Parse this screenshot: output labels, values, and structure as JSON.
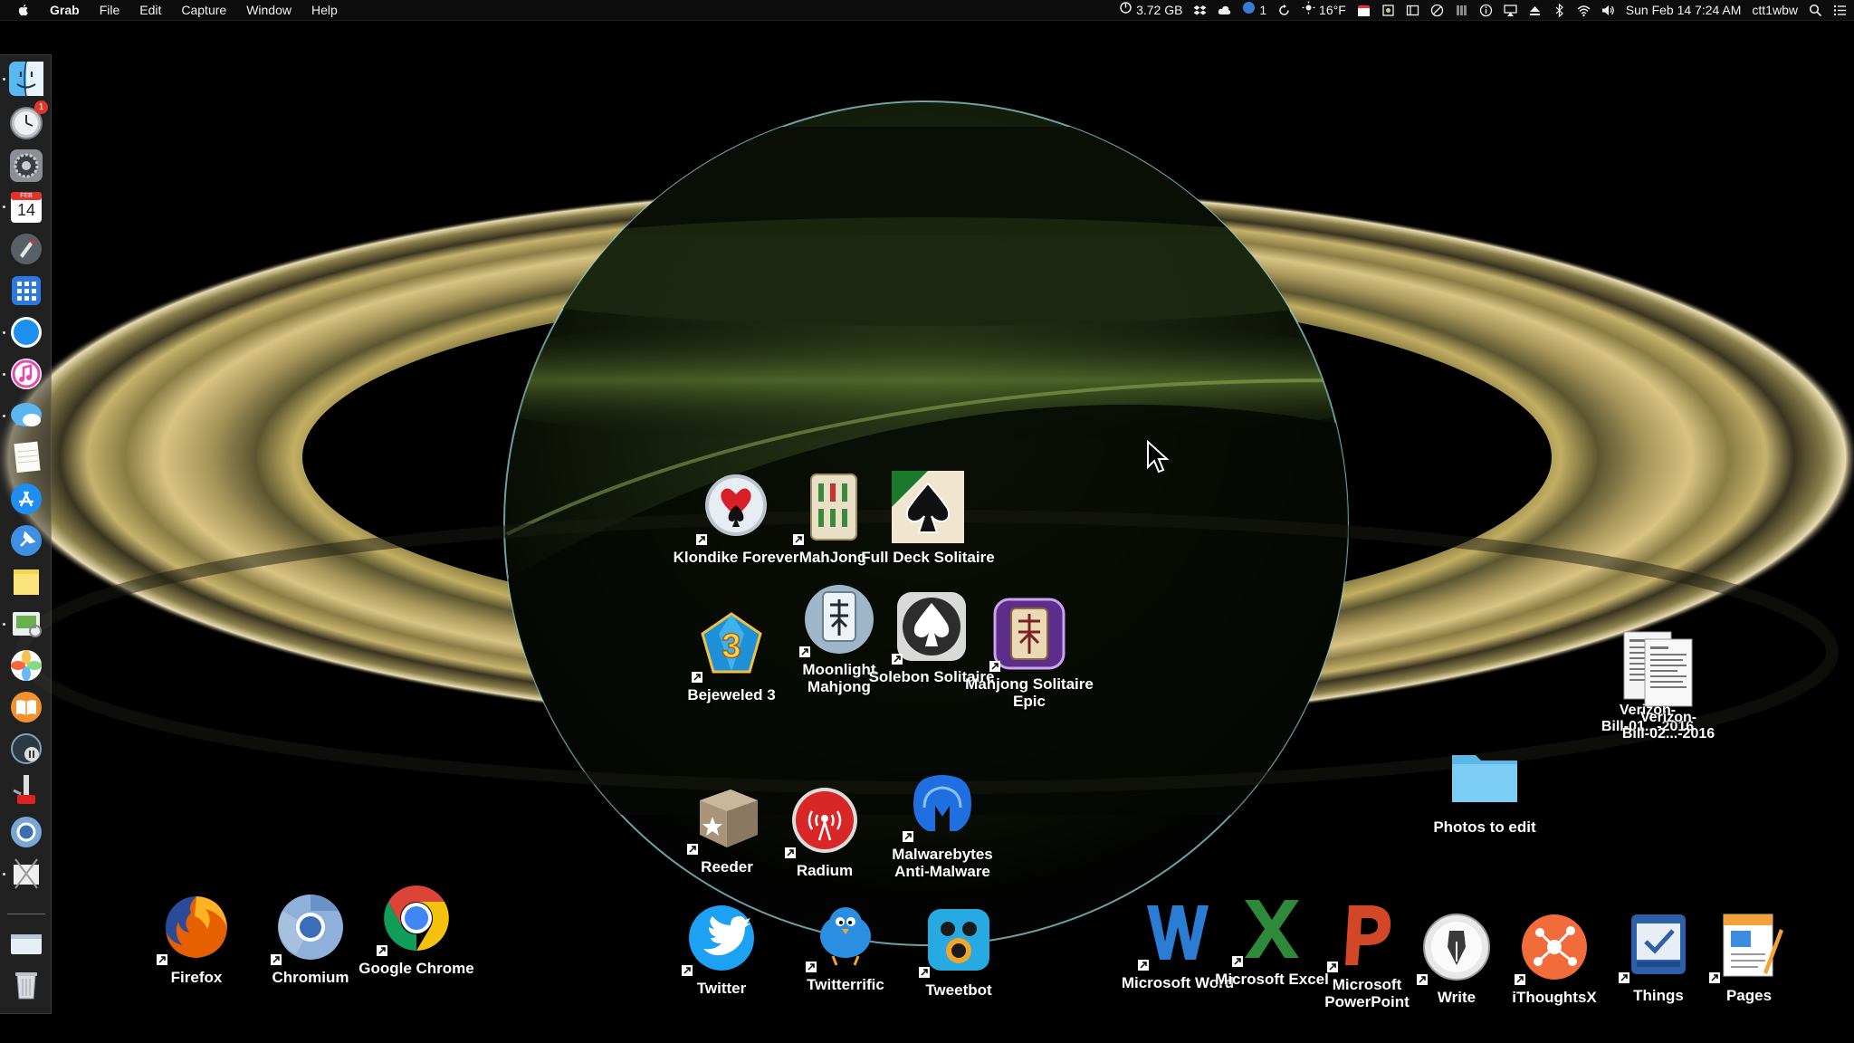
{
  "menubar": {
    "app_name": "Grab",
    "menus": [
      "File",
      "Edit",
      "Capture",
      "Window",
      "Help"
    ],
    "memory": "3.72 GB",
    "badge_count": "1",
    "weather": "16°F",
    "datetime": "Sun Feb 14  7:24 AM",
    "user": "ctt1wbw"
  },
  "dock": {
    "calendar_month": "FEB",
    "calendar_day": "14",
    "notification_badge": "1",
    "items": [
      "finder-icon",
      "clock-icon",
      "system-preferences-icon",
      "calendar-icon",
      "launchpad-icon",
      "dashboard-icon",
      "safari-icon",
      "itunes-icon",
      "messages-icon",
      "notes-icon",
      "app-store-icon",
      "pin-icon",
      "stickies-icon",
      "preview-icon",
      "photos-icon",
      "ibooks-icon",
      "time-machine-icon",
      "utility-icon",
      "chromium-icon",
      "screenshot-icon",
      "mail-window-icon",
      "trash-icon"
    ]
  },
  "desktop": {
    "games": [
      {
        "name": "klondike-forever-icon",
        "label": "Klondike Forever"
      },
      {
        "name": "mahjong-icon",
        "label": "MahJong"
      },
      {
        "name": "full-deck-solitaire-icon",
        "label": "Full Deck Solitaire"
      },
      {
        "name": "bejeweled-3-icon",
        "label": "Bejeweled 3"
      },
      {
        "name": "moonlight-mahjong-icon",
        "label": "Moonlight Mahjong"
      },
      {
        "name": "solebon-solitaire-icon",
        "label": "Solebon Solitaire"
      },
      {
        "name": "mahjong-solitaire-epic-icon",
        "label": "Mahjong Solitaire Epic"
      }
    ],
    "tools": [
      {
        "name": "reeder-icon",
        "label": "Reeder"
      },
      {
        "name": "radium-icon",
        "label": "Radium"
      },
      {
        "name": "malwarebytes-icon",
        "label": "Malwarebytes Anti-Malware"
      }
    ],
    "browsers": [
      {
        "name": "firefox-icon",
        "label": "Firefox"
      },
      {
        "name": "chromium-icon",
        "label": "Chromium"
      },
      {
        "name": "google-chrome-icon",
        "label": "Google Chrome"
      }
    ],
    "twitter_apps": [
      {
        "name": "twitter-icon",
        "label": "Twitter"
      },
      {
        "name": "twitterrific-icon",
        "label": "Twitterrific"
      },
      {
        "name": "tweetbot-icon",
        "label": "Tweetbot"
      }
    ],
    "office_apps": [
      {
        "name": "microsoft-word-icon",
        "label": "Microsoft Word"
      },
      {
        "name": "microsoft-excel-icon",
        "label": "Microsoft Excel"
      },
      {
        "name": "microsoft-powerpoint-icon",
        "label": "Microsoft PowerPoint"
      },
      {
        "name": "write-icon",
        "label": "Write"
      },
      {
        "name": "ithoughtsx-icon",
        "label": "iThoughtsX"
      },
      {
        "name": "things-icon",
        "label": "Things"
      },
      {
        "name": "pages-icon",
        "label": "Pages"
      }
    ],
    "files": [
      {
        "name": "verizon-bill-1",
        "label_line1": "Verizon-",
        "label_line2": "Bill-01...-2016"
      },
      {
        "name": "verizon-bill-2",
        "label_line1": "Verizon-",
        "label_line2": "Bill-02...-2016"
      }
    ],
    "folder": {
      "label": "Photos to edit"
    }
  },
  "colors": {
    "menubar_bg": "#0d0d0d",
    "ring_gold": "#b9a65a",
    "planet_green": "#3d5a22",
    "folder_blue": "#6cc4ef"
  }
}
